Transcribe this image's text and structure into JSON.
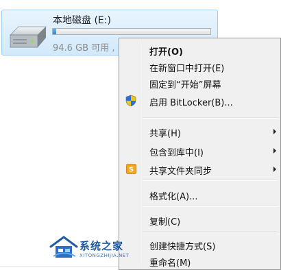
{
  "drive": {
    "name": "本地磁盘 (E:)",
    "free_text": "94.6 GB 可用 ,",
    "usage_fraction": 0.02
  },
  "menu": {
    "items": [
      {
        "label": "打开(O)"
      },
      {
        "label": "在新窗口中打开(E)"
      },
      {
        "label": "固定到“开始”屏幕"
      },
      {
        "label": "启用 BitLocker(B)...",
        "icon": "uac-shield-icon"
      },
      {
        "label": "共享(H)",
        "submenu": true
      },
      {
        "label": "包含到库中(I)",
        "submenu": true
      },
      {
        "label": "共享文件夹同步",
        "icon": "sync-app-icon",
        "submenu": true
      },
      {
        "label": "格式化(A)..."
      },
      {
        "label": "复制(C)"
      },
      {
        "label": "创建快捷方式(S)"
      },
      {
        "label": "重命名(M)"
      }
    ]
  },
  "watermark": {
    "title": "系统之家",
    "subtitle": "XITONGZHIJIA.NET"
  },
  "colors": {
    "tile_border": "#9fcdf3",
    "usage_fill": "#2a8ad8",
    "menu_bg": "#f0f0f0",
    "watermark": "#1f5aa8"
  }
}
